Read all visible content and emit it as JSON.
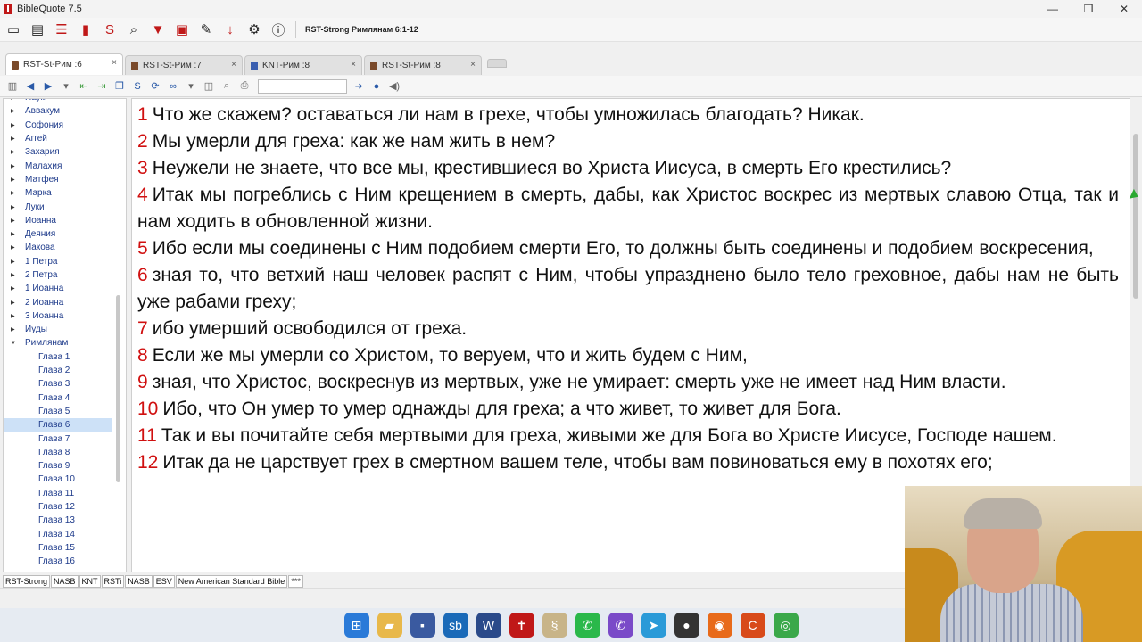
{
  "window": {
    "title": "BibleQuote 7.5",
    "controls": [
      "—",
      "❐",
      "✕"
    ]
  },
  "toolbar": {
    "icons": [
      "window-icon",
      "new-window-icon",
      "lines-icon",
      "book-icon",
      "strongs-icon",
      "search-icon",
      "bookmark-icon",
      "memo-icon",
      "notes-icon",
      "download-icon",
      "settings-icon",
      "info-icon"
    ],
    "reference": "RST-Strong Римлянам 6:1-12"
  },
  "tabs": [
    {
      "label": "RST-St-Рим :6",
      "active": true,
      "book": "brown"
    },
    {
      "label": "RST-St-Рим :7",
      "active": false,
      "book": "brown"
    },
    {
      "label": "KNT-Рим :8",
      "active": false,
      "book": "blue"
    },
    {
      "label": "RST-St-Рим :8",
      "active": false,
      "book": "brown"
    }
  ],
  "sidebar": {
    "books": [
      "Наум",
      "Аввакум",
      "Софония",
      "Аггей",
      "Захария",
      "Малахия",
      "Матфея",
      "Марка",
      "Луки",
      "Иоанна",
      "Деяния",
      "Иакова",
      "1 Петра",
      "2 Петра",
      "1 Иоанна",
      "2 Иоанна",
      "3 Иоанна",
      "Иуды",
      "Римлянам"
    ],
    "chapters": [
      "Глава 1",
      "Глава 2",
      "Глава 3",
      "Глава 4",
      "Глава 5",
      "Глава 6",
      "Глава 7",
      "Глава 8",
      "Глава 9",
      "Глава 10",
      "Глава 11",
      "Глава 12",
      "Глава 13",
      "Глава 14",
      "Глава 15",
      "Глава 16"
    ],
    "selected_chapter": "Глава 6"
  },
  "verses": [
    {
      "n": "1",
      "text": "Что же скажем? оставаться ли нам в грехе, чтобы умножилась благодать? Никак."
    },
    {
      "n": "2",
      "text": "Мы умерли для греха: как же нам жить в нем?"
    },
    {
      "n": "3",
      "text": "Неужели не знаете, что все мы, крестившиеся во Христа Иисуса, в смерть Его крестились?"
    },
    {
      "n": "4",
      "text": "Итак мы погреблись с Ним крещением в смерть, дабы, как Христос воскрес из мертвых славою Отца, так и нам ходить в обновленной жизни."
    },
    {
      "n": "5",
      "text": "Ибо если мы соединены с Ним подобием смерти Его, то должны быть соединены и подобием воскресения,"
    },
    {
      "n": "6",
      "text": "зная то, что ветхий наш человек распят с Ним, чтобы упразднено было тело греховное, дабы нам не быть уже рабами греху;"
    },
    {
      "n": "7",
      "text": "ибо умерший освободился от греха."
    },
    {
      "n": "8",
      "text": "Если же мы умерли со Христом, то веруем, что и жить будем с Ним,"
    },
    {
      "n": "9",
      "text": "зная, что Христос, воскреснув из мертвых, уже не умирает: смерть уже не имеет над Ним власти."
    },
    {
      "n": "10",
      "text": "Ибо, что Он умер то умер однажды для греха; а что живет, то живет для Бога."
    },
    {
      "n": "11",
      "text": "Так и вы почитайте себя мертвыми для греха, живыми же для Бога во Христе Иисусе, Господе нашем."
    },
    {
      "n": "12",
      "text": "Итак да не царствует грех в смертном вашем теле, чтобы вам повиноваться ему в похотях его;"
    }
  ],
  "modules": [
    "RST-Strong",
    "NASB",
    "KNT",
    "RSTi",
    "NASB",
    "ESV",
    "New American Standard Bible",
    "***"
  ],
  "taskbar": [
    "windows-icon",
    "file-explorer-icon",
    "save-icon",
    "app-icon",
    "word-icon",
    "biblequote-icon",
    "scroll-icon",
    "whatsapp-icon",
    "viber-icon",
    "telegram-icon",
    "chat-icon",
    "firefox-icon",
    "ccleaner-icon",
    "chrome-icon"
  ]
}
